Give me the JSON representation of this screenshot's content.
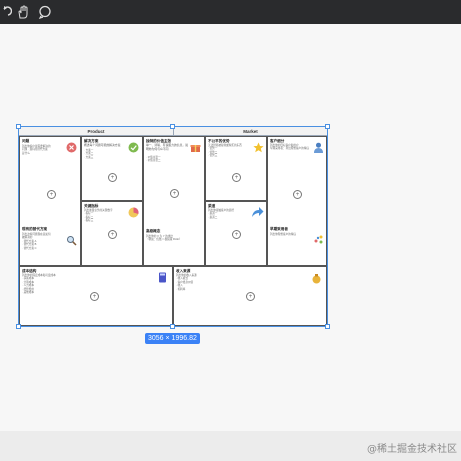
{
  "toolbar": {
    "icons": [
      "undo-icon",
      "hand-icon",
      "comment-icon"
    ]
  },
  "canvas": {
    "headers": {
      "product": "Product",
      "market": "Market"
    },
    "cells": {
      "problem": {
        "title": "问题",
        "desc": "列出你客户最需要解决的 1-3 个问题",
        "lines": [
          "列出你客户最需要解决的",
          "问题 · 现有的替代方案",
          "是什么"
        ]
      },
      "existing_alternatives": {
        "title": "现有的替代方案",
        "lines": [
          "列出这些问题现在是如何",
          "被解决的",
          "· 替代方案 A",
          "· 替代方案 B",
          "· 替代方案 C"
        ]
      },
      "solution": {
        "title": "解决方案",
        "desc": "概述每个问题可能的解决方案",
        "lines": [
          "· 方案一",
          "· 方案二",
          "· 方案三"
        ]
      },
      "key_metrics": {
        "title": "关键指标",
        "lines": [
          "列出衡量业务的关键数字",
          "· 指标一",
          "· 指标二",
          "· 指标三"
        ]
      },
      "uvp": {
        "title": "独特的价值主张",
        "desc": "单一、清晰、有说服力的信息，说明你为何与众不同",
        "lines": [
          "· 价值主张一",
          "· 价值主张二"
        ]
      },
      "high_level_concept": {
        "title": "高级概念",
        "lines": [
          "列出你的 X 为 Y 的类比",
          "（例如：优酷 = 视频版 Flickr）"
        ]
      },
      "unfair_advantage": {
        "title": "不公平的优势",
        "lines": [
          "无法轻易被复制或购买的东西",
          "· 优势一",
          "· 优势二",
          "· 优势三"
        ]
      },
      "channels": {
        "title": "渠道",
        "lines": [
          "列出你接触客户的途径",
          "· 渠道一",
          "· 渠道二"
        ]
      },
      "customer_segments": {
        "title": "客户细分",
        "lines": [
          "列出你的目标客户和用户",
          "早期采用者：列出理想客户的特征"
        ]
      },
      "early_adopters": {
        "title": "早期采用者",
        "lines": [
          "列出你理想客户的特征"
        ]
      },
      "cost_structure": {
        "title": "成本结构",
        "lines": [
          "列出你的固定成本和可变成本",
          "· 获客成本",
          "· 分销成本",
          "· 人力成本",
          "· 托管费用",
          "· 其他成本"
        ]
      },
      "revenue_streams": {
        "title": "收入来源",
        "lines": [
          "列出你的收入来源",
          "· 收入模式",
          "· 客户终身价值",
          "· 收入",
          "· 毛利率"
        ]
      }
    }
  },
  "selection": {
    "size_label": "3056 × 1996.82"
  },
  "watermark": "@稀土掘金技术社区"
}
